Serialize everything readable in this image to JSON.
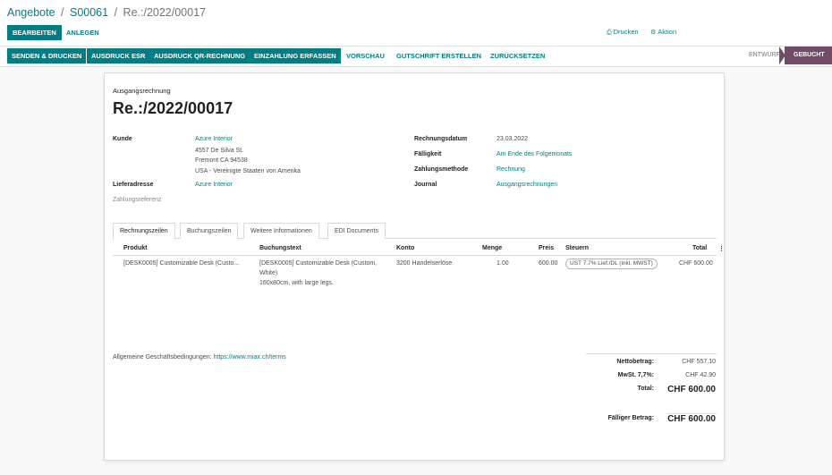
{
  "breadcrumb": {
    "parent": "Angebote",
    "sep": "/",
    "order": "S00061",
    "current": "Re.:/2022/00017"
  },
  "toolbar": {
    "edit": "BEARBEITEN",
    "create": "ANLEGEN",
    "print": "Drucken",
    "action": "Aktion",
    "print_icon": "print-icon",
    "action_icon": "gear-icon"
  },
  "header_buttons": {
    "send_print": "SENDEN & DRUCKEN",
    "print_esr": "AUSDRUCK ESR",
    "print_qr": "AUSDRUCK QR-RECHNUNG",
    "register_payment": "EINZAHLUNG ERFASSEN",
    "preview": "VORSCHAU",
    "credit_note": "GUTSCHRIFT ERSTELLEN",
    "reset": "ZURÜCKSETZEN"
  },
  "status": {
    "draft": "ENTWURF",
    "posted": "GEBUCHT",
    "active_color": "#714b67"
  },
  "invoice": {
    "type_label": "Ausgangsrechnung",
    "number": "Re.:/2022/00017",
    "customer_label": "Kunde",
    "customer": "Azure Interior",
    "address_line1": "4557 De Silva St.",
    "address_line2": "Fremont CA 94538",
    "address_line3": "USA - Vereinigte Staaten von Amerika",
    "delivery_label": "Lieferadresse",
    "delivery": "Azure Interior",
    "payment_ref_label": "Zahlungsreferenz",
    "invoice_date_label": "Rechnungsdatum",
    "invoice_date": "23.03.2022",
    "due_label": "Fälligkeit",
    "due": "Am Ende des Folgemonats",
    "payment_method_label": "Zahlungsmethode",
    "payment_method": "Rechnung",
    "journal_label": "Journal",
    "journal": "Ausgangsrechnungen"
  },
  "tabs": [
    "Rechnungszeilen",
    "Buchungszeilen",
    "Weitere Informationen",
    "EDI Documents"
  ],
  "lines": {
    "headers": {
      "product": "Produkt",
      "label": "Buchungstext",
      "account": "Konto",
      "qty": "Menge",
      "price": "Preis",
      "taxes": "Steuern",
      "total": "Total"
    },
    "rows": [
      {
        "product": "[DESK0005] Customizable Desk (Custo...",
        "label1": "[DESK0005] Customizable Desk (Custom,",
        "label2": "White)",
        "label3": "160x80cm, with large legs.",
        "account": "3200 Handelserlöse",
        "qty": "1.00",
        "price": "600.00",
        "tax": "UST 7.7% Lief./DL (inkl. MWST)",
        "total": "CHF 600.00"
      }
    ]
  },
  "terms": {
    "label": "Allgemeine Geschäftsbedingungen:",
    "link": "https://www.miax.ch/terms"
  },
  "totals": {
    "untaxed_label": "Nettobetrag:",
    "untaxed": "CHF 557.10",
    "tax_label": "MwSt. 7,7%:",
    "tax": "CHF 42.90",
    "total_label": "Total:",
    "total": "CHF 600.00",
    "due_label": "Fälliger Betrag:",
    "due": "CHF 600.00"
  }
}
